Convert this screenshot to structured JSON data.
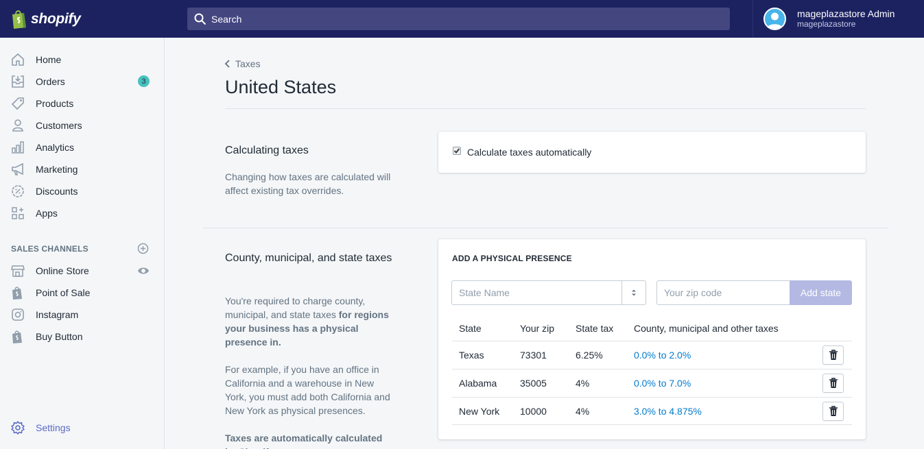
{
  "brand": {
    "name": "shopify"
  },
  "search": {
    "placeholder": "Search"
  },
  "account": {
    "name": "mageplazastore Admin",
    "store": "mageplazastore"
  },
  "sidebar": {
    "items": [
      {
        "label": "Home",
        "icon": "home-icon"
      },
      {
        "label": "Orders",
        "icon": "orders-icon",
        "badge": "3"
      },
      {
        "label": "Products",
        "icon": "tag-icon"
      },
      {
        "label": "Customers",
        "icon": "person-icon"
      },
      {
        "label": "Analytics",
        "icon": "bar-chart-icon"
      },
      {
        "label": "Marketing",
        "icon": "megaphone-icon"
      },
      {
        "label": "Discounts",
        "icon": "discount-icon"
      },
      {
        "label": "Apps",
        "icon": "apps-icon"
      }
    ],
    "sales_channels_heading": "SALES CHANNELS",
    "channels": [
      {
        "label": "Online Store",
        "icon": "store-icon"
      },
      {
        "label": "Point of Sale",
        "icon": "shopify-bag-icon"
      },
      {
        "label": "Instagram",
        "icon": "instagram-icon"
      },
      {
        "label": "Buy Button",
        "icon": "shopify-bag-icon"
      }
    ],
    "settings": {
      "label": "Settings",
      "icon": "gear-icon"
    }
  },
  "breadcrumb": {
    "label": "Taxes"
  },
  "page": {
    "title": "United States"
  },
  "calculating": {
    "title": "Calculating taxes",
    "description": "Changing how taxes are calculated will affect existing tax overrides.",
    "checkbox_label": "Calculate taxes automatically",
    "checked": true
  },
  "county": {
    "title": "County, municipal, and state taxes",
    "desc1_plain": "You're required to charge county, municipal, and state taxes ",
    "desc1_bold": "for regions your business has a physical presence in.",
    "desc2": "For example, if you have an office in California and a warehouse in New York, you must add both California and New York as physical presences.",
    "desc3_bold": "Taxes are automatically calculated by Shopify."
  },
  "presence": {
    "heading": "ADD A PHYSICAL PRESENCE",
    "state_placeholder": "State Name",
    "zip_placeholder": "Your zip code",
    "add_button": "Add state",
    "columns": [
      "State",
      "Your zip",
      "State tax",
      "County, municipal and other taxes"
    ],
    "rows": [
      {
        "state": "Texas",
        "zip": "73301",
        "state_tax": "6.25%",
        "other": "0.0% to 2.0%"
      },
      {
        "state": "Alabama",
        "zip": "35005",
        "state_tax": "4%",
        "other": "0.0% to 7.0%"
      },
      {
        "state": "New York",
        "zip": "10000",
        "state_tax": "4%",
        "other": "3.0% to 4.875%"
      }
    ]
  }
}
